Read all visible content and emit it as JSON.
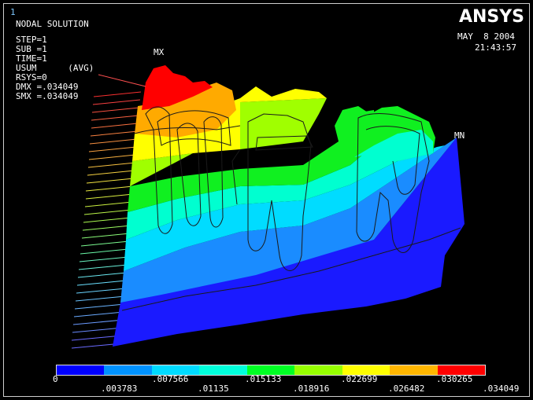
{
  "window_number": "1",
  "logo": "ANSYS",
  "date": "MAY  8 2004",
  "time": "21:43:57",
  "info_lines": [
    "NODAL SOLUTION",
    "",
    "STEP=1",
    "SUB =1",
    "TIME=1",
    "USUM      (AVG)",
    "RSYS=0",
    "DMX =.034049",
    "SMX =.034049"
  ],
  "max_label": "MX",
  "min_label": "MN",
  "legend": {
    "colors": [
      "#0000ff",
      "#0092ff",
      "#00dbff",
      "#00ffdb",
      "#00ff24",
      "#96ff00",
      "#ffff00",
      "#ffb600",
      "#ff0000"
    ],
    "ticks_lower": [
      "0",
      ".007566",
      ".01135",
      ".015133",
      ".022699",
      ".030265"
    ],
    "ticks_upper": [
      ".003783",
      ".018916",
      ".026482",
      ".034049"
    ]
  }
}
